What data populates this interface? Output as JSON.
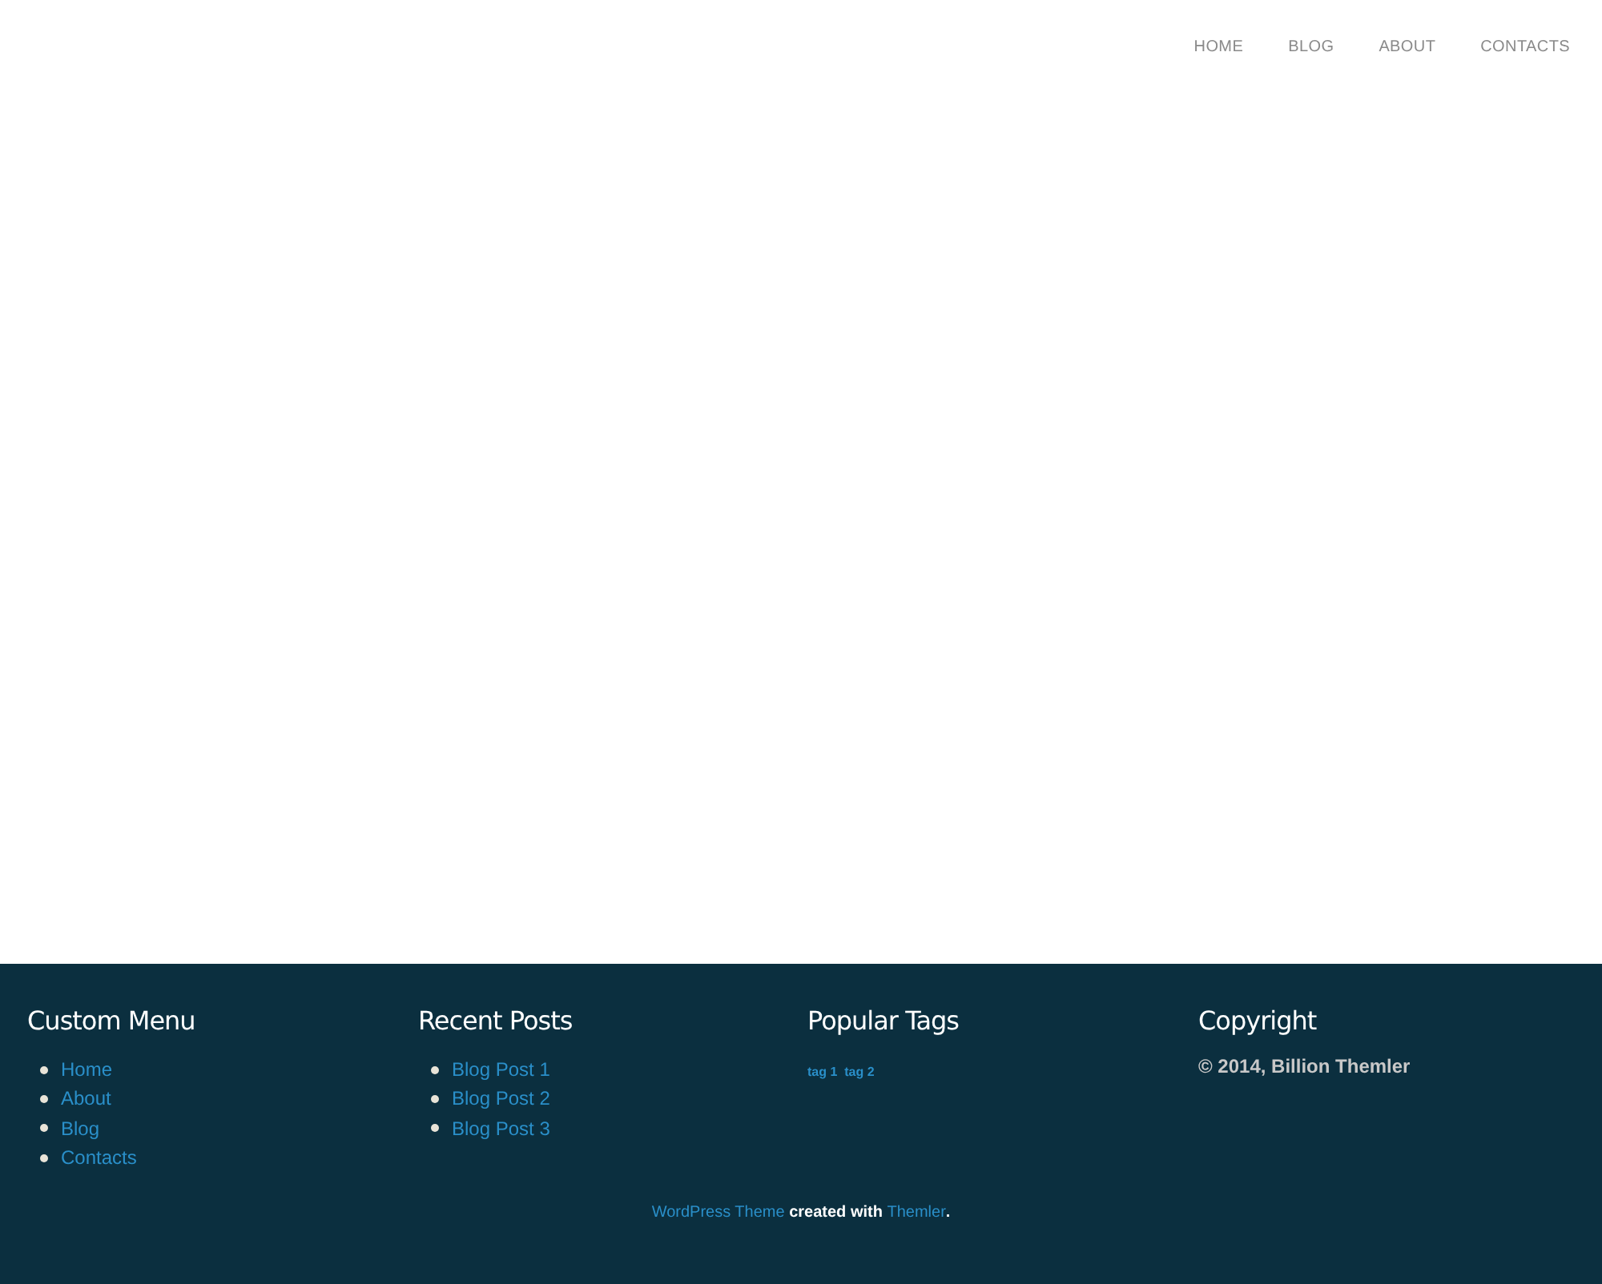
{
  "nav": [
    {
      "label": "HOME"
    },
    {
      "label": "BLOG"
    },
    {
      "label": "ABOUT"
    },
    {
      "label": "CONTACTS"
    }
  ],
  "footer": {
    "widgets": [
      {
        "kind": "list",
        "title": "Custom Menu",
        "items": [
          "Home",
          "About",
          "Blog",
          "Contacts"
        ]
      },
      {
        "kind": "list",
        "title": "Recent Posts",
        "items": [
          "Blog Post 1",
          "Blog Post 2",
          "Blog Post 3"
        ]
      },
      {
        "kind": "tags",
        "title": "Popular Tags",
        "items": [
          "tag 1",
          "tag 2"
        ]
      },
      {
        "kind": "text",
        "title": "Copyright",
        "text": "© 2014, Billion Themler"
      }
    ],
    "credit": {
      "link_1": "WordPress Theme",
      "middle": "created with",
      "link_2": "Themler",
      "end": "."
    }
  }
}
